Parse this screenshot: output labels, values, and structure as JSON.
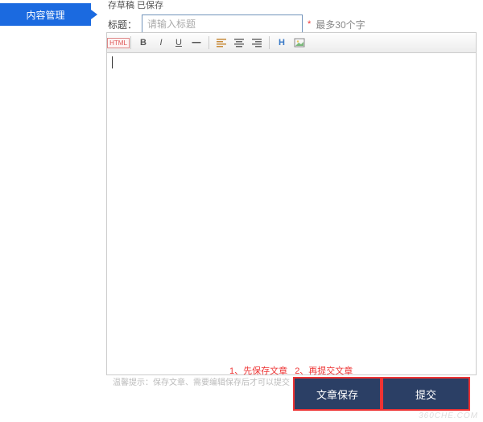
{
  "sidebar": {
    "tab_label": "内容管理"
  },
  "form": {
    "top_partial": "存草稿 已保存",
    "title_label": "标题：",
    "title_placeholder": "请输入标题",
    "title_hint_star": "*",
    "title_hint": "最多30个字"
  },
  "toolbar": {
    "html": "HTML",
    "bold": "B",
    "italic": "I",
    "underline": "U",
    "strike": "—",
    "heading": "H",
    "more": "…"
  },
  "notes": {
    "step1": "1、先保存文章",
    "step2": "2、再提交文章"
  },
  "helper_text": "温馨提示：保存文章、需要编辑保存后才可以提交",
  "buttons": {
    "save": "文章保存",
    "submit": "提交"
  },
  "watermark": "360CHE.COM"
}
